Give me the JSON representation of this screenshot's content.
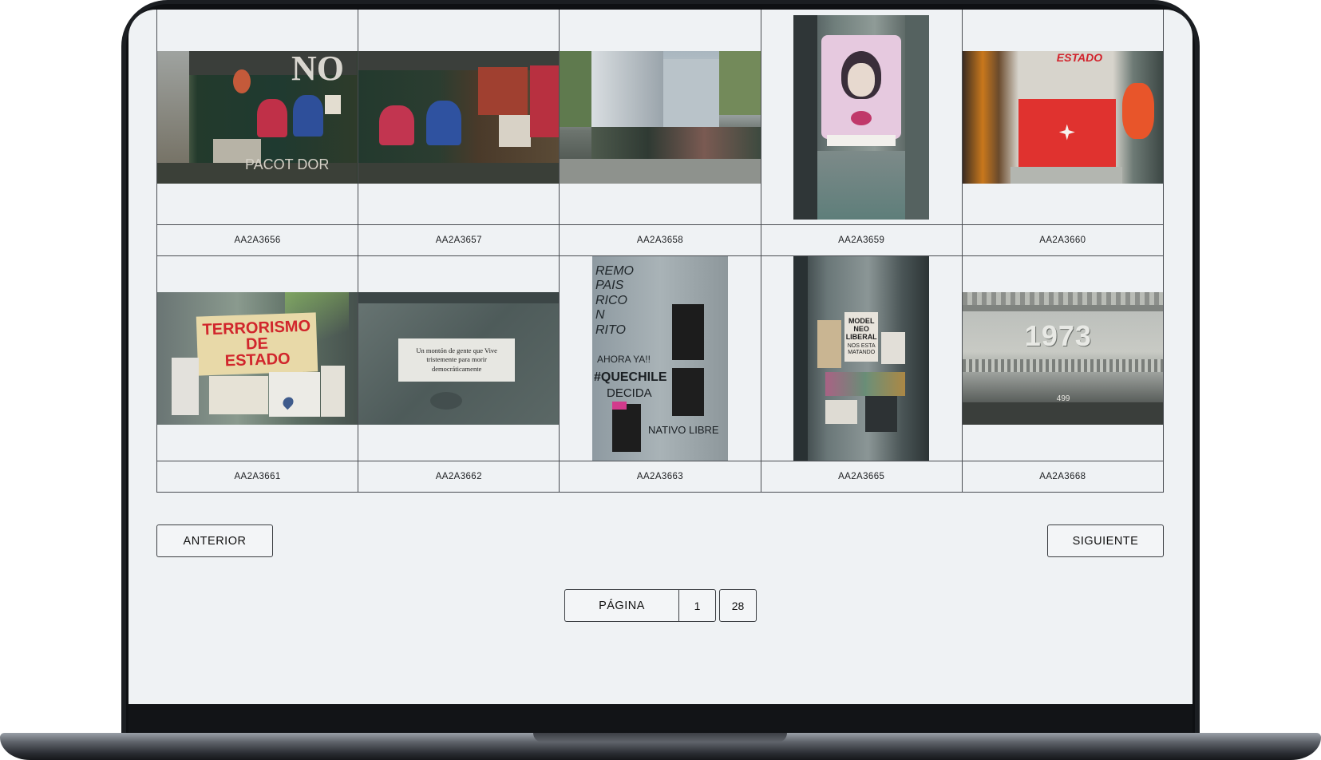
{
  "gallery": {
    "items": [
      {
        "code": "AA2A3656",
        "orientation": "landscape"
      },
      {
        "code": "AA2A3657",
        "orientation": "landscape"
      },
      {
        "code": "AA2A3658",
        "orientation": "landscape"
      },
      {
        "code": "AA2A3659",
        "orientation": "portrait"
      },
      {
        "code": "AA2A3660",
        "orientation": "landscape"
      },
      {
        "code": "AA2A3661",
        "orientation": "landscape"
      },
      {
        "code": "AA2A3662",
        "orientation": "landscape"
      },
      {
        "code": "AA2A3663",
        "orientation": "portrait"
      },
      {
        "code": "AA2A3665",
        "orientation": "portrait"
      },
      {
        "code": "AA2A3668",
        "orientation": "landscape"
      }
    ],
    "image_text": {
      "wall_letters": "NO",
      "wall_bottom": "PACOT DOR",
      "sign_star": "ESTADO",
      "terror_line1": "TERRORISMO",
      "terror_line2": "DE",
      "terror_line3": "ESTADO",
      "letter_line1": "Un montón de gente que Vive",
      "letter_line2": "tristemente para morir",
      "letter_line3": "democráticamente",
      "graffiti_1": "#QUECHILE",
      "graffiti_2": "DECIDA",
      "graffiti_3": "NATIVO LIBRE",
      "graffiti_4": "AHORA YA!!",
      "poster_model": "MODEL NEO LIBERAL",
      "poster_model_sub": "NOS ESTA MATANDO",
      "year": "1973",
      "door_number": "499"
    }
  },
  "navigation": {
    "prev_label": "ANTERIOR",
    "next_label": "SIGUIENTE",
    "page_label": "PÁGINA",
    "current_page": "1",
    "total_pages": "28"
  },
  "colors": {
    "screen_bg": "#eff2f4",
    "border": "#4a4d52",
    "red_banner": "#e0322f",
    "poster_yellow": "#e8d9a8"
  }
}
